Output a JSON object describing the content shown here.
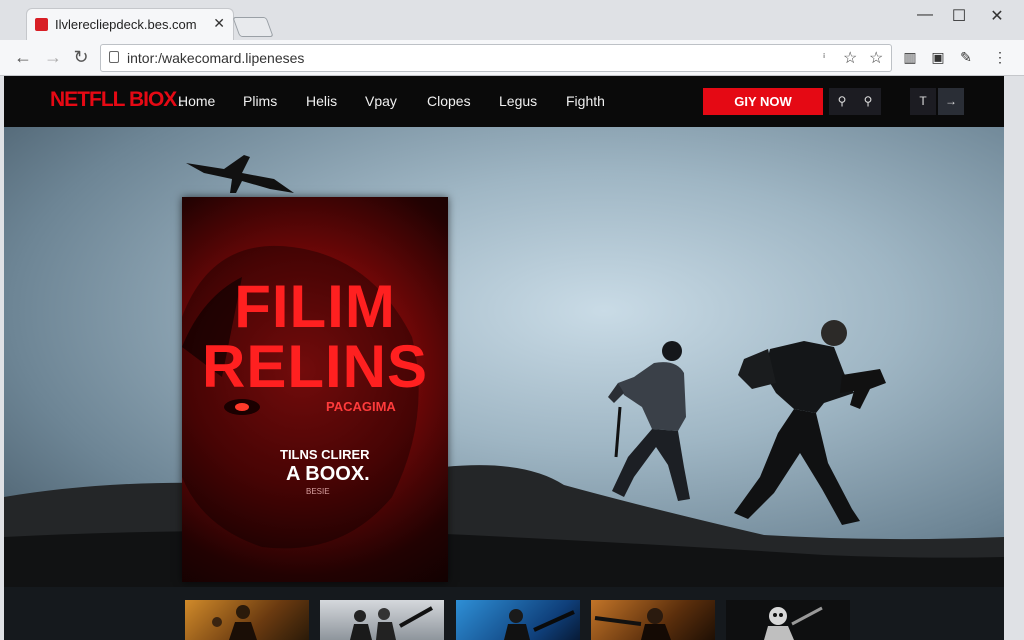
{
  "browser": {
    "tab_title": "Ilvlerecliepdeck.bes.com",
    "tab_close": "✕",
    "url": "intor:/wakecomard.lipeneses",
    "window_min": "—",
    "window_max": "☐",
    "window_close": "✕"
  },
  "site": {
    "logo": "NETFLL BIOX",
    "logo_suffix": "...",
    "nav": [
      "Home",
      "Plims",
      "Helis",
      "Vpay",
      "Clopes",
      "Legus",
      "Fighth"
    ],
    "buy_label": "GIY NOW",
    "search_icon_1": "🔍",
    "search_icon_2": "🔍",
    "icon_t": "T",
    "icon_arrow": "→",
    "accent": "#e50914"
  },
  "poster": {
    "title_line1": "FILIM",
    "title_line2": "RELINS",
    "subtitle": "PACAGIMA",
    "tag_line1": "TILNS CLIRER",
    "tag_line2": "A BOOX.",
    "tag_line3": "BESIE"
  }
}
